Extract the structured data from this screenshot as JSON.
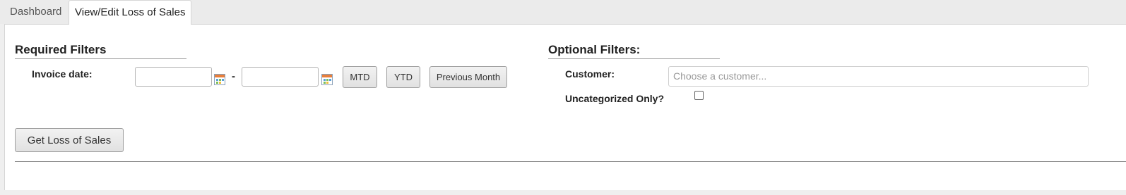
{
  "tabs": {
    "dashboard": "Dashboard",
    "active": "View/Edit Loss of Sales"
  },
  "required": {
    "title": "Required Filters",
    "invoice_label": "Invoice date:",
    "date_from": "",
    "date_to": "",
    "separator": "-",
    "mtd_label": "MTD",
    "ytd_label": "YTD",
    "prev_month_label": "Previous Month",
    "calendar_icon": "calendar-icon"
  },
  "optional": {
    "title": "Optional Filters:",
    "customer_label": "Customer:",
    "customer_placeholder": "Choose a customer...",
    "uncategorized_label": "Uncategorized Only?",
    "uncategorized_checked": false
  },
  "actions": {
    "get_label": "Get Loss of Sales"
  }
}
